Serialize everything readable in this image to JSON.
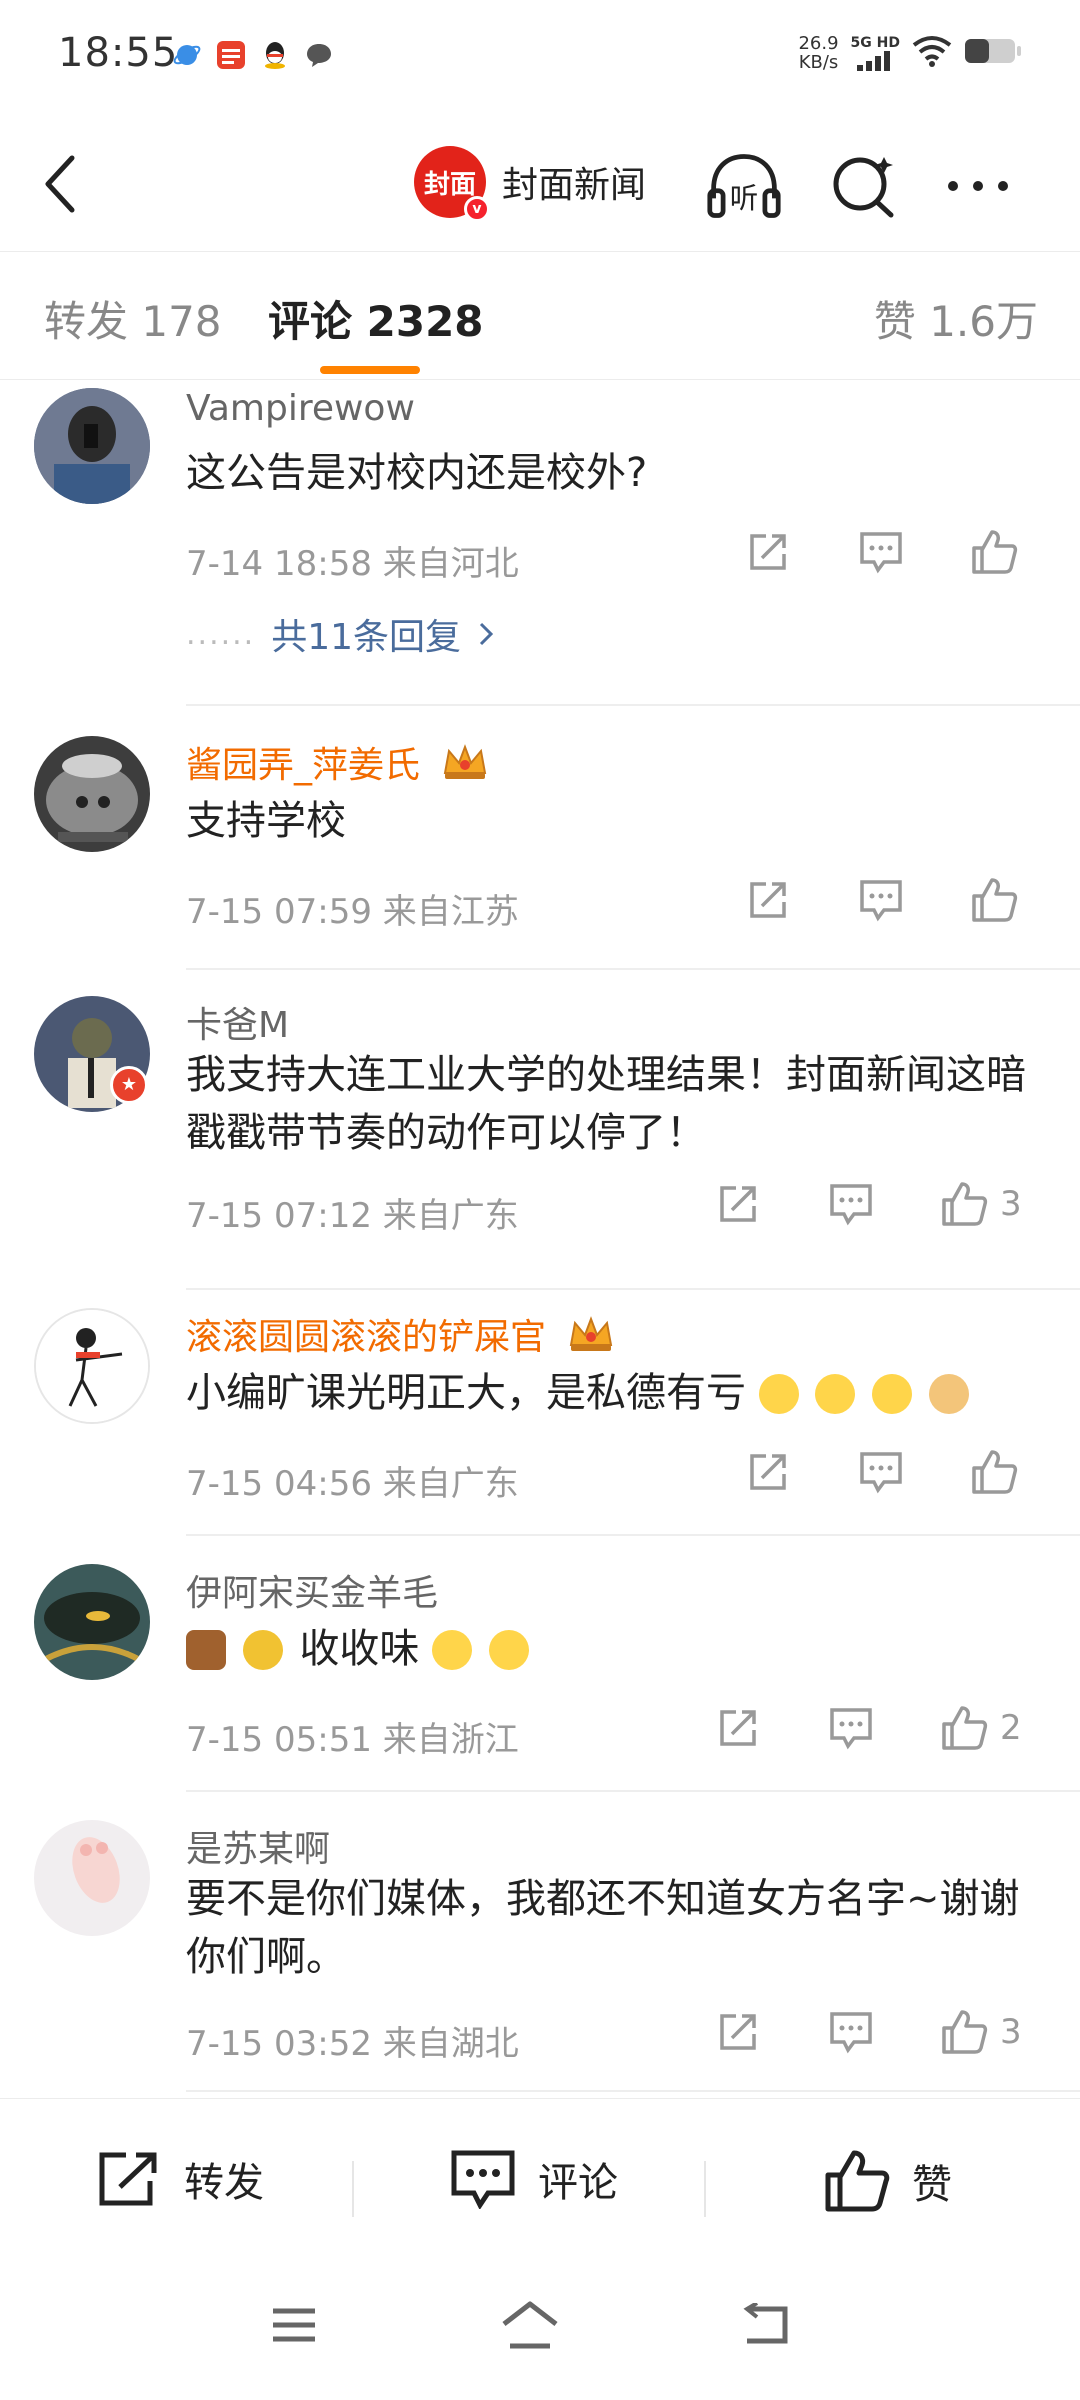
{
  "status_bar": {
    "time": "18:55",
    "net_speed_value": "26.9",
    "net_speed_unit": "KB/s",
    "network": "5G HD",
    "icons": [
      "browser-icon",
      "news-app-icon",
      "qq-icon",
      "message-icon",
      "signal-icon",
      "wifi-icon",
      "battery-icon"
    ]
  },
  "header": {
    "brand_name": "封面新闻",
    "logo_text": "封面",
    "verified_mark": "v",
    "listen_label": "听",
    "colors": {
      "brand_red": "#e2231a",
      "accent_orange": "#ff8200"
    }
  },
  "tabs": {
    "repost": "转发 178",
    "comments": "评论 2328",
    "likes": "赞 1.6万"
  },
  "comments": [
    {
      "username": "Vampirewow",
      "name_style": "normal",
      "text": "这公告是对校内还是校外?",
      "meta": "7-14 18:58  来自河北",
      "likes": "",
      "replies": {
        "dots": "......",
        "label": "共11条回复"
      }
    },
    {
      "username": "酱园弄_萍姜氏",
      "name_style": "vip",
      "text": "支持学校",
      "meta": "7-15 07:59  来自江苏",
      "likes": ""
    },
    {
      "username": "卡爸M",
      "name_style": "normal",
      "text": "我支持大连工业大学的处理结果！封面新闻这暗戳戳带节奏的动作可以停了！",
      "meta": "7-15 07:12  来自广东",
      "likes": "3"
    },
    {
      "username": "滚滚圆圆滚滚的铲屎官",
      "name_style": "vip",
      "text": "小编旷课光明正大，是私德有亏",
      "emojis": [
        "laugh-cry-emoji",
        "laugh-cry-emoji",
        "laugh-cry-emoji",
        "doge-emoji"
      ],
      "meta": "7-15 04:56  来自广东",
      "likes": ""
    },
    {
      "username": "伊阿宋买金羊毛",
      "name_style": "normal",
      "text_prefix_icons": [
        "wood-emoji",
        "hook-emoji"
      ],
      "text": "收收味",
      "emojis": [
        "smirk-emoji",
        "smirk-emoji"
      ],
      "meta": "7-15 05:51  来自浙江",
      "likes": "2"
    },
    {
      "username": "是苏某啊",
      "name_style": "normal",
      "text": "要不是你们媒体，我都还不知道女方名字~谢谢你们啊。",
      "meta": "7-15 03:52  来自湖北",
      "likes": "3"
    }
  ],
  "bottom_bar": {
    "repost": "转发",
    "comment": "评论",
    "like": "赞"
  },
  "nav": {
    "icons": [
      "menu-icon",
      "home-icon",
      "back-nav-icon"
    ]
  }
}
